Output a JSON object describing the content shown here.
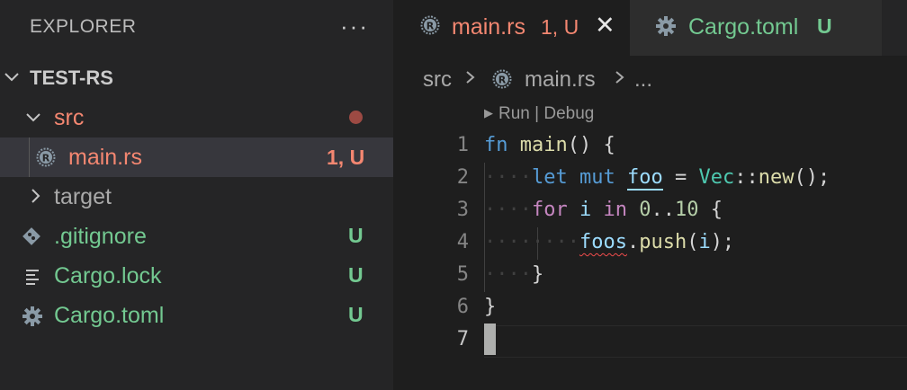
{
  "explorer": {
    "title": "EXPLORER",
    "more_label": "···",
    "root": "TEST-RS",
    "items": [
      {
        "label": "src",
        "decoration": "●",
        "icon": "chevron-down-icon"
      },
      {
        "label": "main.rs",
        "decoration": "1, U",
        "icon": "rust-icon"
      },
      {
        "label": "target",
        "decoration": "",
        "icon": "chevron-right-icon"
      },
      {
        "label": ".gitignore",
        "decoration": "U",
        "icon": "git-icon"
      },
      {
        "label": "Cargo.lock",
        "decoration": "U",
        "icon": "lines-icon"
      },
      {
        "label": "Cargo.toml",
        "decoration": "U",
        "icon": "gear-icon"
      }
    ]
  },
  "tabs": [
    {
      "label": "main.rs",
      "decoration": "1, U",
      "close": "✕",
      "icon": "rust-icon"
    },
    {
      "label": "Cargo.toml",
      "decoration": "U",
      "icon": "gear-icon"
    }
  ],
  "breadcrumb": {
    "folder": "src",
    "file": "main.rs",
    "ellipsis": "..."
  },
  "codelens": {
    "run": "Run",
    "sep": "|",
    "debug": "Debug"
  },
  "line_numbers": [
    "1",
    "2",
    "3",
    "4",
    "5",
    "6",
    "7"
  ],
  "code": {
    "l1": {
      "fn": "fn",
      "name": "main",
      "rest": "() {"
    },
    "l2": {
      "let": "let",
      "mut": "mut",
      "var": "foo",
      "eq": " = ",
      "type": "Vec",
      "sep": "::",
      "call": "new",
      "end": "();"
    },
    "l3": {
      "for": "for",
      "i": "i",
      "in": "in",
      "from": "0",
      "range": "..",
      "to": "10",
      "brace": " {"
    },
    "l4": {
      "var": "foos",
      "dot": ".",
      "call": "push",
      "open": "(",
      "arg": "i",
      "close": ");"
    },
    "l5": {
      "brace": "}"
    },
    "l6": {
      "brace": "}"
    }
  },
  "colors": {
    "modified_red": "#f48771",
    "untracked_green": "#73c991",
    "background": "#1e1e1e"
  }
}
